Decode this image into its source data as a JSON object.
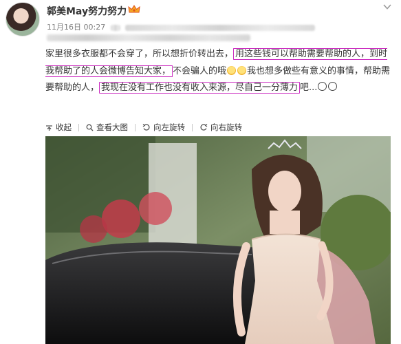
{
  "post": {
    "username": "郭美May努力努力",
    "date": "11月16日 00:27",
    "text_segments": [
      {
        "text": "家里很多衣服都不会穿了，所以想折价转出去，",
        "highlight": false
      },
      {
        "text": "用这些钱可以帮助需要帮助的人，到时我帮助了的人会微博告知大家，",
        "highlight": true
      },
      {
        "text": "不会骗人的哦",
        "highlight": false
      },
      {
        "text": "我也想多做些有意义的事情，帮助需要帮助的人，",
        "highlight": false
      },
      {
        "text": "我现在没有工作也没有收入来源，尽自己一分薄力",
        "highlight": true
      },
      {
        "text": "吧...",
        "highlight": false
      }
    ],
    "highlight_color": "#cc2fc1"
  },
  "actions": [
    {
      "label": "收起",
      "icon": "collapse-icon"
    },
    {
      "label": "查看大图",
      "icon": "zoom-icon"
    },
    {
      "label": "向左旋转",
      "icon": "rotate-left-icon"
    },
    {
      "label": "向右旋转",
      "icon": "rotate-right-icon"
    }
  ],
  "icons": {
    "vip": "crown-vip-icon",
    "menu": "chevron-down-icon"
  }
}
